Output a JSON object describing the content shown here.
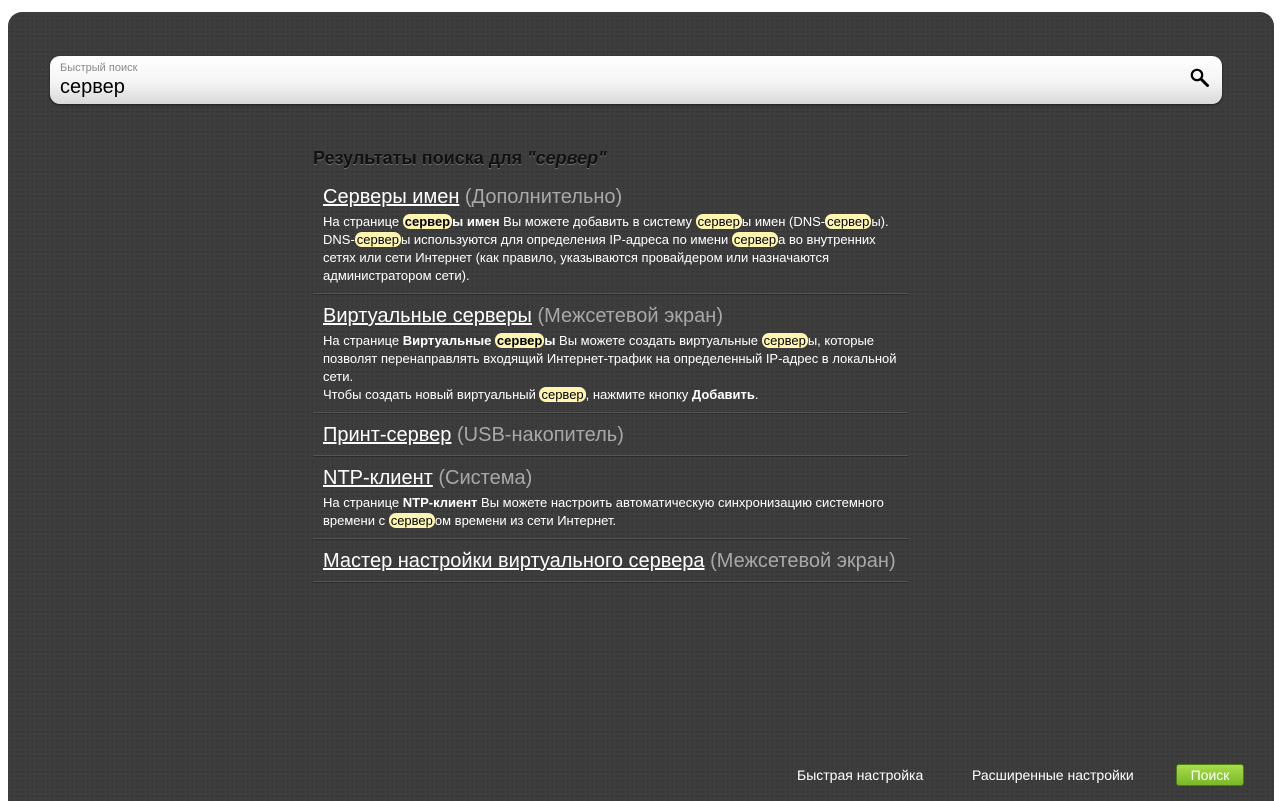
{
  "search": {
    "label": "Быстрый поиск",
    "value": "сервер"
  },
  "heading": {
    "prefix": "Результаты поиска для ",
    "query": "\"сервер\""
  },
  "highlight_color": "#fff5b0",
  "accent_green": "#8cc63f",
  "results": [
    {
      "title": "Серверы имен",
      "section": "(Дополнительно)",
      "desc": [
        [
          "На странице ",
          ""
        ],
        [
          "сервер",
          "hlb"
        ],
        [
          "ы имен",
          "b"
        ],
        [
          " Вы можете добавить в систему ",
          ""
        ],
        [
          "сервер",
          "hl"
        ],
        [
          "ы имен (DNS-",
          ""
        ],
        [
          "сервер",
          "hl"
        ],
        [
          "ы).",
          ""
        ],
        [
          "\n",
          "br"
        ],
        [
          "DNS-",
          ""
        ],
        [
          "сервер",
          "hl"
        ],
        [
          "ы используются для определения IP-адреса по имени ",
          ""
        ],
        [
          "сервер",
          "hl"
        ],
        [
          "а во внутренних сетях или сети Интернет (как правило, указываются провайдером или назначаются администратором сети).",
          ""
        ]
      ]
    },
    {
      "title": "Виртуальные серверы",
      "section": "(Межсетевой экран)",
      "desc": [
        [
          "На странице ",
          ""
        ],
        [
          "Виртуальные ",
          "b"
        ],
        [
          "сервер",
          "hlb"
        ],
        [
          "ы",
          "b"
        ],
        [
          " Вы можете создать виртуальные ",
          ""
        ],
        [
          "сервер",
          "hl"
        ],
        [
          "ы, которые позволят перенаправлять входящий Интернет-трафик на определенный IP-адрес в локальной сети.",
          ""
        ],
        [
          "\n",
          "br"
        ],
        [
          "Чтобы создать новый виртуальный ",
          ""
        ],
        [
          "сервер",
          "hl"
        ],
        [
          ", нажмите кнопку ",
          ""
        ],
        [
          "Добавить",
          "b"
        ],
        [
          ".",
          ""
        ]
      ]
    },
    {
      "title": "Принт-сервер",
      "section": "(USB-накопитель)",
      "desc": []
    },
    {
      "title": "NTP-клиент",
      "section": "(Система)",
      "desc": [
        [
          "На странице ",
          ""
        ],
        [
          "NTP-клиент",
          "b"
        ],
        [
          " Вы можете настроить автоматическую синхронизацию системного времени с ",
          ""
        ],
        [
          "сервер",
          "hl"
        ],
        [
          "ом времени из сети Интернет.",
          ""
        ]
      ]
    },
    {
      "title": "Мастер настройки виртуального сервера",
      "section": "(Межсетевой экран)",
      "desc": []
    }
  ],
  "footer": {
    "quick_setup": "Быстрая настройка",
    "advanced_settings": "Расширенные настройки",
    "search_button": "Поиск"
  }
}
